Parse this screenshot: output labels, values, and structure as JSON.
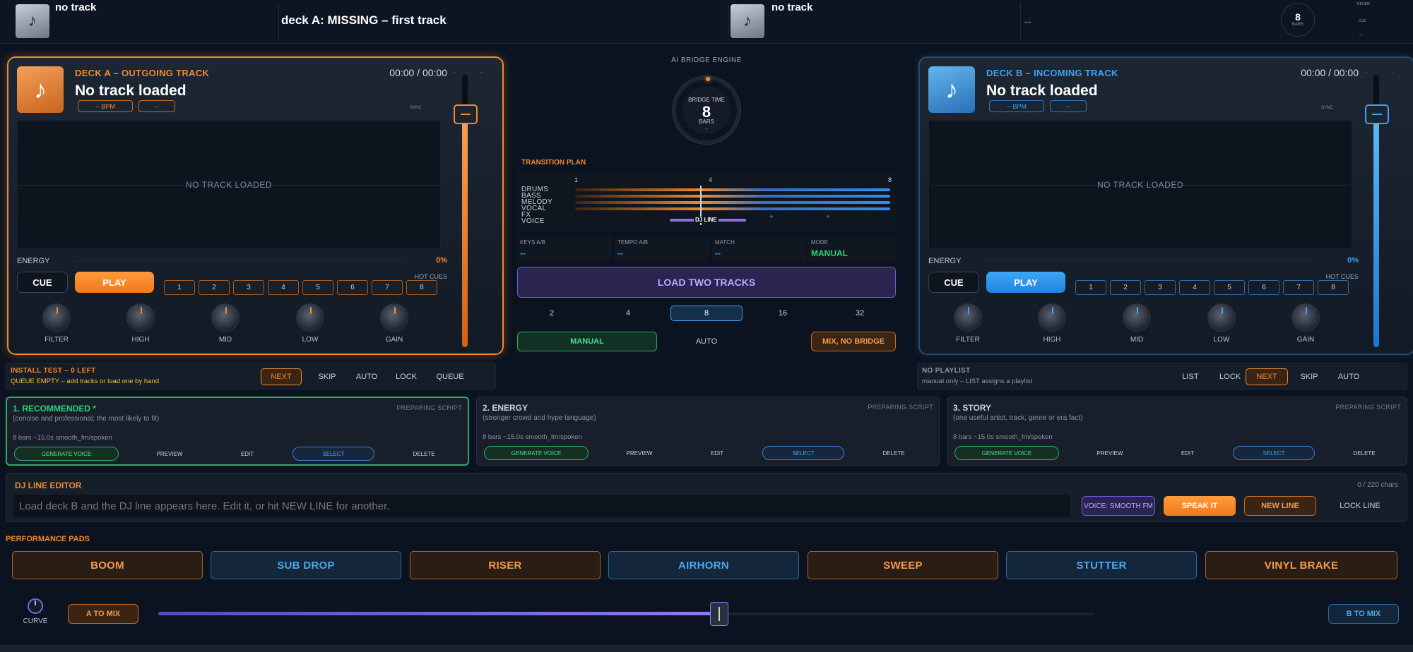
{
  "topbar": {
    "a_track": "no track",
    "status": "deck A: MISSING – first track",
    "b_track": "no track",
    "b_status": "--",
    "bars_value": "8",
    "bars_label": "BARS",
    "side_1": "REGEN",
    "side_2": "CUE",
    "side_3": "---"
  },
  "deckA": {
    "label": "DECK A  –  OUTGOING TRACK",
    "title": "No track loaded",
    "time": "00:00 / 00:00",
    "bpm": "-- BPM",
    "key": "--",
    "sync": "SYNC",
    "wave_empty": "NO TRACK LOADED",
    "energy_label": "ENERGY",
    "energy_value": "0%",
    "hot_cues_label": "HOT CUES",
    "cue_label": "CUE",
    "play_label": "PLAY",
    "cues": [
      "1",
      "2",
      "3",
      "4",
      "5",
      "6",
      "7",
      "8"
    ],
    "knobs": [
      "FILTER",
      "HIGH",
      "MID",
      "LOW",
      "GAIN"
    ],
    "fader_level": 0.84,
    "fader_ticks": [
      "-",
      "-"
    ]
  },
  "deckB": {
    "label": "DECK B  –  INCOMING TRACK",
    "title": "No track loaded",
    "time": "00:00 / 00:00",
    "bpm": "-- BPM",
    "key": "--",
    "sync": "SYNC",
    "wave_empty": "NO TRACK LOADED",
    "energy_label": "ENERGY",
    "energy_value": "0%",
    "hot_cues_label": "HOT CUES",
    "cue_label": "CUE",
    "play_label": "PLAY",
    "cues": [
      "1",
      "2",
      "3",
      "4",
      "5",
      "6",
      "7",
      "8"
    ],
    "knobs": [
      "FILTER",
      "HIGH",
      "MID",
      "LOW",
      "GAIN"
    ],
    "fader_level": 0.84,
    "fader_ticks": [
      "-",
      "-"
    ]
  },
  "bridge": {
    "engine_label": "AI BRIDGE ENGINE",
    "ring_top": "BRIDGE TIME",
    "ring_value": "8",
    "ring_unit": "BARS",
    "ring_sub": "--",
    "plan_label": "TRANSITION PLAN",
    "ticks": [
      "1",
      "4",
      "8"
    ],
    "stems": [
      "DRUMS",
      "BASS",
      "MELODY",
      "VOCAL",
      "FX",
      "VOICE"
    ],
    "djline_label": "DJ LINE",
    "plus": [
      "+",
      "+"
    ],
    "stats": [
      {
        "label": "KEYS A/B",
        "value": "--"
      },
      {
        "label": "TEMPO A/B",
        "value": "--"
      },
      {
        "label": "MATCH",
        "value": "--"
      },
      {
        "label": "MODE",
        "value": "MANUAL"
      }
    ],
    "load_label": "LOAD TWO TRACKS",
    "bar_options": [
      "2",
      "4",
      "8",
      "16",
      "32"
    ],
    "bar_selected": "8",
    "mode_manual": "MANUAL",
    "mode_auto": "AUTO",
    "mode_nobridge": "MIX, NO BRIDGE"
  },
  "queueA": {
    "title": "INSTALL TEST  –  0 LEFT",
    "sub": "QUEUE EMPTY – add tracks or load one by hand",
    "buttons": [
      "NEXT",
      "SKIP",
      "AUTO",
      "LOCK",
      "QUEUE"
    ]
  },
  "queueB": {
    "title": "NO PLAYLIST",
    "sub": "manual only – LIST assigns a playlist",
    "buttons": [
      "LIST",
      "LOCK",
      "NEXT",
      "SKIP",
      "AUTO"
    ]
  },
  "scripts": [
    {
      "title": "1.  RECOMMENDED  *",
      "desc": "(concise and professional; the most likely to fit)",
      "meta": "8 bars  ~15.0s   smooth_fm/spoken",
      "state": "PREPARING SCRIPT"
    },
    {
      "title": "2.  ENERGY",
      "desc": "(stronger crowd and hype language)",
      "meta": "8 bars  ~15.0s   smooth_fm/spoken",
      "state": "PREPARING SCRIPT"
    },
    {
      "title": "3.  STORY",
      "desc": "(one useful artist, track, genre or era fact)",
      "meta": "8 bars  ~15.0s   smooth_fm/spoken",
      "state": "PREPARING SCRIPT"
    }
  ],
  "script_buttons": {
    "generate": "GENERATE VOICE",
    "preview": "PREVIEW",
    "edit": "EDIT",
    "select": "SELECT",
    "delete": "DELETE"
  },
  "editor": {
    "title": "DJ LINE EDITOR",
    "count": "0 / 220 chars",
    "placeholder": "Load deck B and the DJ line appears here. Edit it, or hit NEW LINE for another.",
    "voice": "VOICE: SMOOTH FM",
    "speak": "SPEAK IT",
    "newline": "NEW LINE",
    "lock": "LOCK LINE"
  },
  "pads": {
    "label": "PERFORMANCE PADS",
    "items": [
      "BOOM",
      "SUB DROP",
      "RISER",
      "AIRHORN",
      "SWEEP",
      "STUTTER",
      "VINYL BRAKE"
    ]
  },
  "crossfader": {
    "curve_label": "CURVE",
    "a_label": "A TO MIX",
    "b_label": "B TO MIX",
    "position": 0.6
  },
  "colors": {
    "orange": "#f08a2c",
    "blue": "#3ea3f0",
    "green": "#2fd078",
    "purple": "#8a70e6"
  }
}
